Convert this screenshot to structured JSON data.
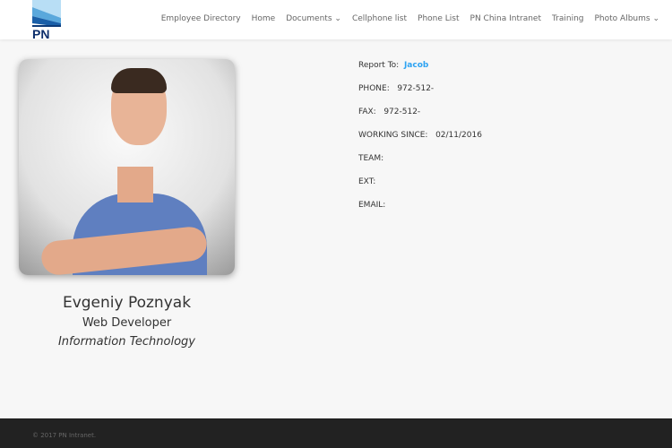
{
  "header": {
    "logo_text": "PN",
    "nav": [
      {
        "label": "Employee Directory"
      },
      {
        "label": "Home"
      },
      {
        "label": "Documents",
        "dropdown": true
      },
      {
        "label": "Cellphone list"
      },
      {
        "label": "Phone List"
      },
      {
        "label": "PN China Intranet"
      },
      {
        "label": "Training"
      },
      {
        "label": "Photo Albums",
        "dropdown": true
      }
    ]
  },
  "profile": {
    "name": "Evgeniy Poznyak",
    "title": "Web Developer",
    "department": "Information Technology"
  },
  "details": [
    {
      "label": "Report To:",
      "value": "Jacob",
      "link": true
    },
    {
      "label": "PHONE:",
      "value": "972-512-"
    },
    {
      "label": "FAX:",
      "value": "972-512-"
    },
    {
      "label": "WORKING SINCE:",
      "value": "02/11/2016"
    },
    {
      "label": "TEAM:",
      "value": ""
    },
    {
      "label": "EXT:",
      "value": ""
    },
    {
      "label": "EMAIL:",
      "value": ""
    }
  ],
  "footer": {
    "copyright": "© 2017 PN Intranet."
  },
  "colors": {
    "accent": "#2ea3f2",
    "footer": "#222222"
  }
}
